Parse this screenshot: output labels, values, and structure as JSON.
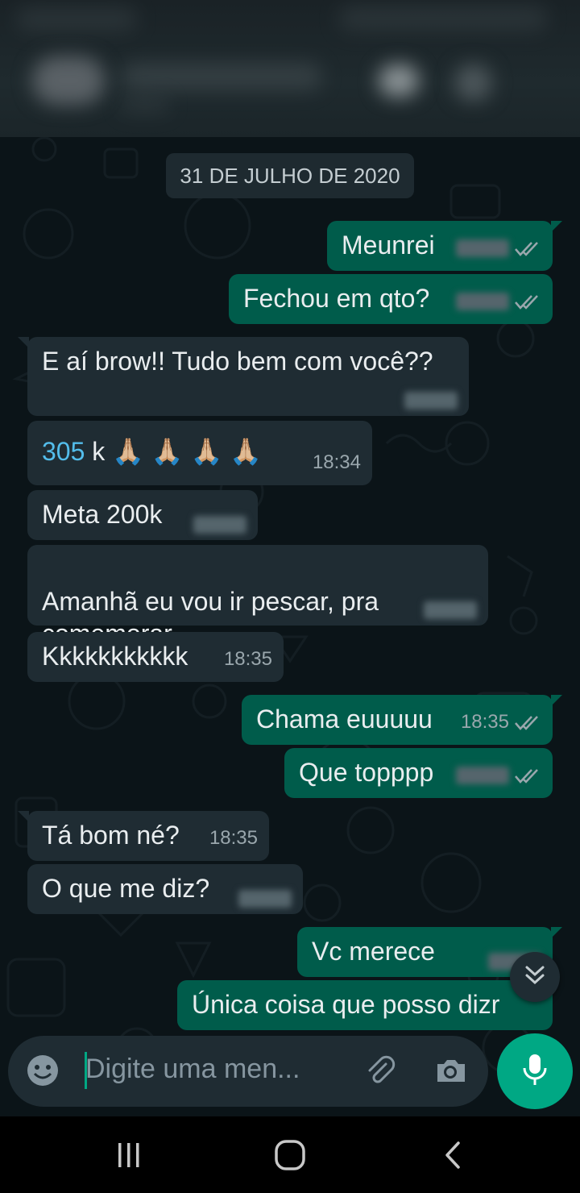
{
  "date_chip": "31 DE JULHO DE 2020",
  "messages": [
    {
      "text": "Meunrei",
      "time": "",
      "dir": "out"
    },
    {
      "text": "Fechou em qto?",
      "time": "",
      "dir": "out"
    },
    {
      "text": "E aí brow!! Tudo bem com você??",
      "time": "",
      "dir": "in"
    },
    {
      "link": "305",
      "text": " k 🙏🏼 🙏🏼 🙏🏼 🙏🏼",
      "time": "18:34",
      "dir": "in"
    },
    {
      "text": "Meta 200k",
      "time": "",
      "dir": "in"
    },
    {
      "text": "Amanhã eu vou ir pescar, pra\ncomemorar",
      "time": "",
      "dir": "in"
    },
    {
      "text": "Kkkkkkkkkkk",
      "time": "18:35",
      "dir": "in"
    },
    {
      "text": "Chama euuuuu",
      "time": "18:35",
      "dir": "out"
    },
    {
      "text": "Que topppp",
      "time": "",
      "dir": "out"
    },
    {
      "text": "Tá bom né?",
      "time": "18:35",
      "dir": "in"
    },
    {
      "text": "O que me diz?",
      "time": "",
      "dir": "in"
    },
    {
      "text": "Vc merece",
      "time": "",
      "dir": "out"
    },
    {
      "text": "Única coisa que posso dizr",
      "time": "",
      "dir": "out"
    }
  ],
  "composer": {
    "placeholder": "Digite uma men..."
  },
  "icons": {
    "emoji": "emoji-icon",
    "attach": "paperclip-icon",
    "camera": "camera-icon",
    "mic": "mic-icon",
    "scroll": "chevron-double-down-icon",
    "recents": "recents-icon",
    "home": "home-icon",
    "back": "back-icon"
  },
  "colors": {
    "outgoing_bubble": "#005c4b",
    "incoming_bubble": "#1f2c33",
    "accent": "#00a884",
    "link": "#53bdeb"
  }
}
